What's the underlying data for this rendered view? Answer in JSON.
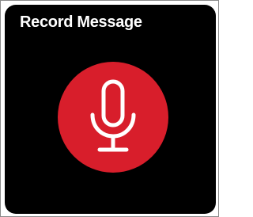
{
  "tile": {
    "title": "Record Message"
  },
  "record_button": {
    "icon": "microphone-icon",
    "color": "#d81e2b"
  },
  "colors": {
    "tile_background": "#000000",
    "title_text": "#ffffff",
    "icon_stroke": "#ffffff"
  }
}
